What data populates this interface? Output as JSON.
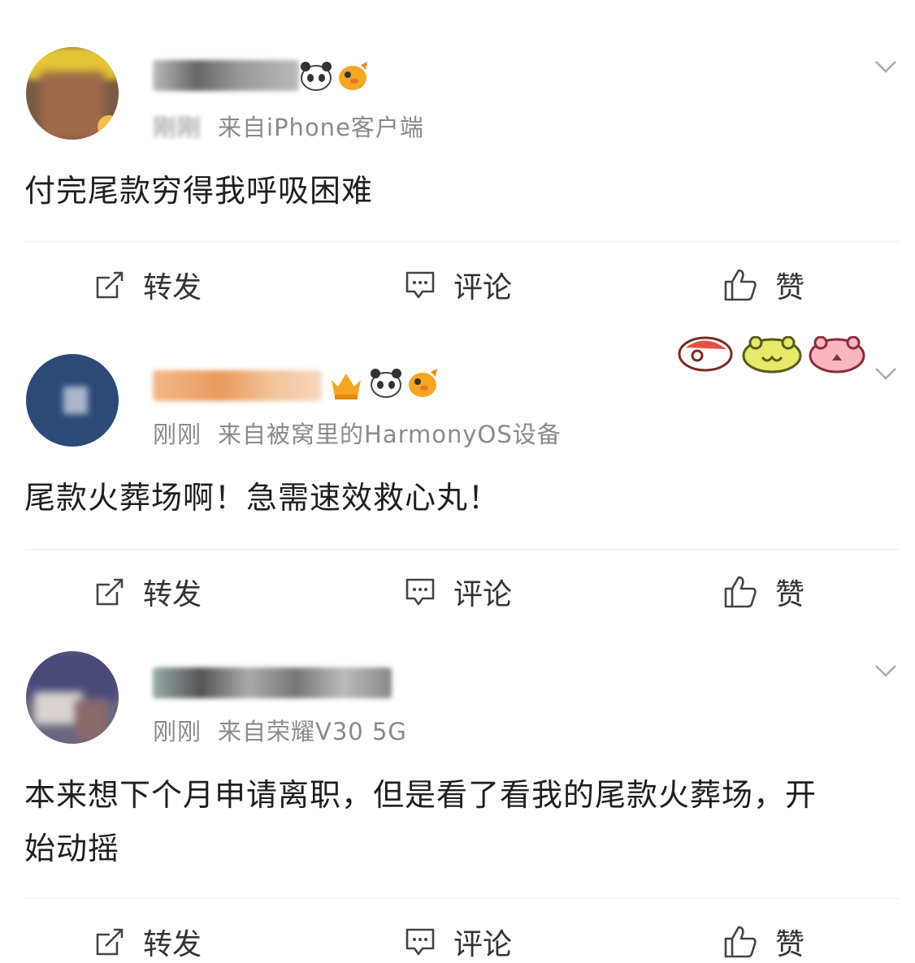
{
  "actions": {
    "repost_label": "转发",
    "comment_label": "评论",
    "like_label": "赞"
  },
  "posts": [
    {
      "time": "刚刚",
      "source": "来自iPhone客户端",
      "content": "付完尾款穷得我呼吸困难"
    },
    {
      "time": "刚刚",
      "source": "来自被窝里的HarmonyOS设备",
      "content": "尾款火葬场啊！急需速效救心丸！"
    },
    {
      "time": "刚刚",
      "source": "来自荣耀V30 5G",
      "content": "本来想下个月申请离职，但是看了看我的尾款火葬场，开始动摇"
    }
  ],
  "colors": {
    "meta_gray": "#8a8a8a",
    "divider": "#ececec",
    "emoji_orange": "#f5a623"
  }
}
